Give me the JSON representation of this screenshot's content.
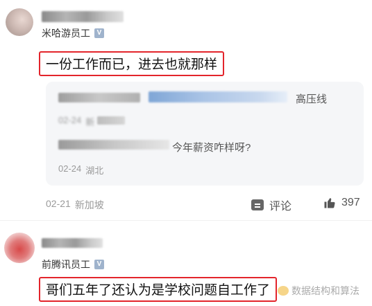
{
  "comment1": {
    "company": "米哈游员工",
    "verified_mark": "V",
    "text": "一份工作而已，进去也就那样",
    "time": "02-21",
    "location": "新加坡",
    "comment_label": "评论",
    "like_count": "397"
  },
  "replies": [
    {
      "suffix": "高压线",
      "time": "02-24",
      "location": "新"
    },
    {
      "text": "今年薪资咋样呀?",
      "time": "02-24",
      "location": "湖北"
    }
  ],
  "comment2": {
    "company": "前腾讯员工",
    "verified_mark": "V",
    "text": "哥们五年了还认为是学校问题自工作了"
  },
  "watermark": {
    "text": "数据结构和算法"
  },
  "icons": {
    "comment": "comment-icon",
    "like": "thumbs-up-icon",
    "verified": "verified-badge-icon"
  }
}
